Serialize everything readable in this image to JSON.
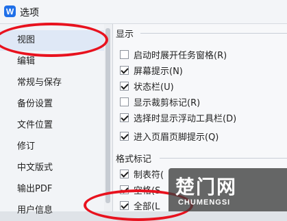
{
  "window": {
    "app_icon_letter": "W",
    "title": "选项"
  },
  "sidebar": {
    "items": [
      {
        "label": "视图",
        "selected": true
      },
      {
        "label": "编辑"
      },
      {
        "label": "常规与保存"
      },
      {
        "label": "备份设置"
      },
      {
        "label": "文件位置"
      },
      {
        "label": "修订"
      },
      {
        "label": "中文版式"
      },
      {
        "label": "输出PDF"
      },
      {
        "label": "用户信息"
      }
    ]
  },
  "display": {
    "group_label": "显示",
    "options": [
      {
        "label": "启动时展开任务窗格(R)",
        "checked": false
      },
      {
        "label": "屏幕提示(N)",
        "checked": true
      },
      {
        "label": "状态栏(U)",
        "checked": true
      },
      {
        "label": "显示裁剪标记(R)",
        "checked": false
      },
      {
        "label": "选择时显示浮动工具栏(D)",
        "checked": true
      },
      {
        "label": "进入页眉页脚提示(Q)",
        "checked": true
      }
    ]
  },
  "format_marks": {
    "group_label": "格式标记",
    "options": [
      {
        "label": "制表符(",
        "checked": true
      },
      {
        "label": "空格(S",
        "checked": true
      },
      {
        "label": "全部(L",
        "checked": true
      }
    ]
  },
  "watermark": {
    "main": "楚门网",
    "sub": "CHUMENGSI"
  }
}
